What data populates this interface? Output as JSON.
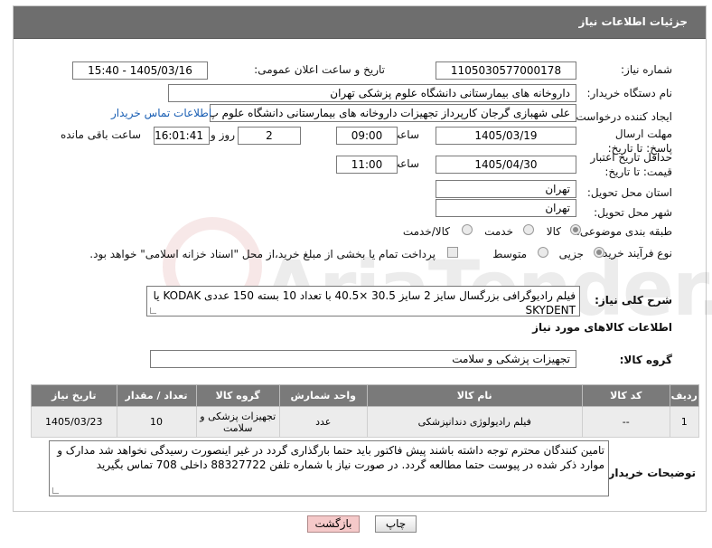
{
  "header": {
    "title": "جزئیات اطلاعات نیاز"
  },
  "form": {
    "need_number_label": "شماره نیاز:",
    "need_number": "1105030577000178",
    "announce_label": "تاریخ و ساعت اعلان عمومی:",
    "announce_value": "1405/03/16 - 15:40",
    "buyer_org_label": "نام دستگاه خریدار:",
    "buyer_org": "داروخانه های بیمارستانی دانشگاه علوم پزشکی تهران",
    "creator_label": "ایجاد کننده درخواست:",
    "creator": "علی شهبازی گرجان کارپرداز تجهیزات داروخانه های بیمارستانی دانشگاه علوم پ",
    "buyer_contact_link": "اطلاعات تماس خریدار",
    "reply_deadline_label": "مهلت ارسال پاسخ: تا تاریخ:",
    "reply_date": "1405/03/19",
    "time_label": "ساعت",
    "reply_time": "09:00",
    "days_value": "2",
    "days_label": "روز و",
    "remaining_time": "16:01:41",
    "remaining_label": "ساعت باقی مانده",
    "price_deadline_label": "حداقل تاریخ اعتبار قیمت: تا تاریخ:",
    "price_date": "1405/04/30",
    "price_time": "11:00",
    "province_label": "استان محل تحویل:",
    "province": "تهران",
    "city_label": "شهر محل تحویل:",
    "city": "تهران",
    "category_label": "طبقه بندی موضوعی:",
    "category_options": [
      "کالا",
      "خدمت",
      "کالا/خدمت"
    ],
    "process_label": "نوع فرآیند خرید :",
    "process_options": [
      "جزیی",
      "متوسط"
    ],
    "payment_note": "پرداخت تمام یا بخشی از مبلغ خرید،از محل \"اسناد خزانه اسلامی\" خواهد بود.",
    "description_label": "شرح کلی نیاز:",
    "description": "فیلم رادیوگرافی بزرگسال سایز 2 سایز 30.5 ×40.5 با تعداد 10 بسته 150 عددی KODAK یا SKYDENT",
    "goods_info_title": "اطلاعات کالاهای مورد نیاز",
    "goods_group_label": "گروه کالا:",
    "goods_group": "تجهیزات پزشکی و سلامت",
    "buyer_notes_label": "توضیحات خریدار:",
    "buyer_notes": "تامین کنندگان محترم توجه داشته باشند پیش فاکتور باید حتما بارگذاری گردد در غیر اینصورت رسیدگی نخواهد شد مدارک و موارد ذکر شده در پیوست حتما مطالعه گردد. در صورت نیاز با شماره تلفن 88327722 داخلی 708 تماس بگیرید"
  },
  "table": {
    "headers": [
      "ردیف",
      "کد کالا",
      "نام کالا",
      "واحد شمارش",
      "گروه کالا",
      "تعداد / مقدار",
      "تاریخ نیاز"
    ],
    "rows": [
      [
        "1",
        "--",
        "فیلم رادیولوژی دندانپزشکی",
        "عدد",
        "تجهیزات پزشکی و سلامت",
        "10",
        "1405/03/23"
      ]
    ]
  },
  "buttons": {
    "print": "چاپ",
    "back": "بازگشت"
  },
  "watermark": "AriaTender.neT"
}
